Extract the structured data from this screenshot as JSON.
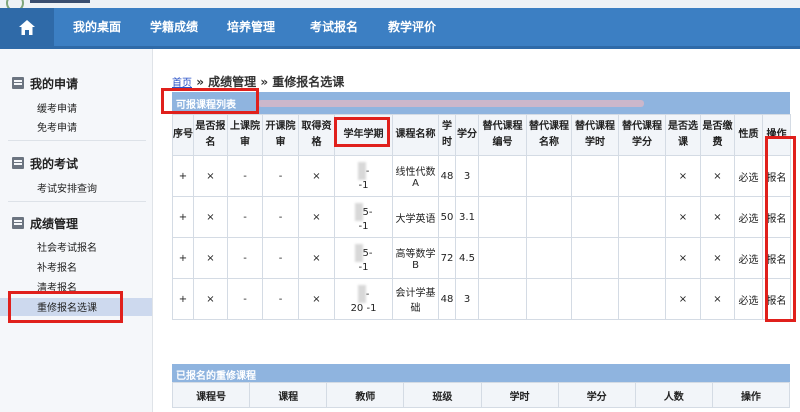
{
  "nav": {
    "items": [
      "我的桌面",
      "学籍成绩",
      "培养管理",
      "考试报名",
      "教学评价"
    ]
  },
  "sidebar": {
    "sections": [
      {
        "title": "我的申请",
        "items": [
          "缓考申请",
          "免考申请"
        ]
      },
      {
        "title": "我的考试",
        "items": [
          "考试安排查询"
        ]
      },
      {
        "title": "成绩管理",
        "items": [
          "社会考试报名",
          "补考报名",
          "清考报名",
          "重修报名选课"
        ]
      }
    ]
  },
  "breadcrumb": {
    "home": "首页",
    "sep": "»",
    "level1": "成绩管理",
    "level2": "重修报名选课"
  },
  "available": {
    "title": "可报课程列表",
    "columns": [
      "序号",
      "是否报名",
      "上课院审",
      "开课院审",
      "取得资格",
      "学年学期",
      "课程名称",
      "学时",
      "学分",
      "替代课程编号",
      "替代课程名称",
      "替代课程学时",
      "替代课程学分",
      "是否选课",
      "是否缴费",
      "性质",
      "操作"
    ],
    "rows": [
      {
        "expand": "+",
        "apply": "×",
        "a": "-",
        "b": "-",
        "q": "×",
        "term_a": "-",
        "term_b": "-1",
        "course": "线性代数A",
        "hours": "48",
        "credit": "3",
        "selected": "×",
        "paid": "×",
        "nature": "必选",
        "action": "报名"
      },
      {
        "expand": "+",
        "apply": "×",
        "a": "-",
        "b": "-",
        "q": "×",
        "term_a": "5-",
        "term_b": "-1",
        "course": "大学英语",
        "hours": "50",
        "credit": "3.1",
        "selected": "×",
        "paid": "×",
        "nature": "必选",
        "action": "报名"
      },
      {
        "expand": "+",
        "apply": "×",
        "a": "-",
        "b": "-",
        "q": "×",
        "term_a": "5-",
        "term_b": "-1",
        "course": "高等数学B",
        "hours": "72",
        "credit": "4.5",
        "selected": "×",
        "paid": "×",
        "nature": "必选",
        "action": "报名"
      },
      {
        "expand": "+",
        "apply": "×",
        "a": "-",
        "b": "-",
        "q": "×",
        "term_a": "-",
        "term_b": "20 -1",
        "course": "会计学基础",
        "hours": "48",
        "credit": "3",
        "selected": "×",
        "paid": "×",
        "nature": "必选",
        "action": "报名"
      }
    ]
  },
  "registered": {
    "title": "已报名的重修课程",
    "columns": [
      "课程号",
      "课程",
      "教师",
      "班级",
      "学时",
      "学分",
      "人数",
      "操作"
    ]
  },
  "colors": {
    "nav": "#3c7fc3",
    "panel": "#8fb4df",
    "highlight": "#e0201c"
  }
}
